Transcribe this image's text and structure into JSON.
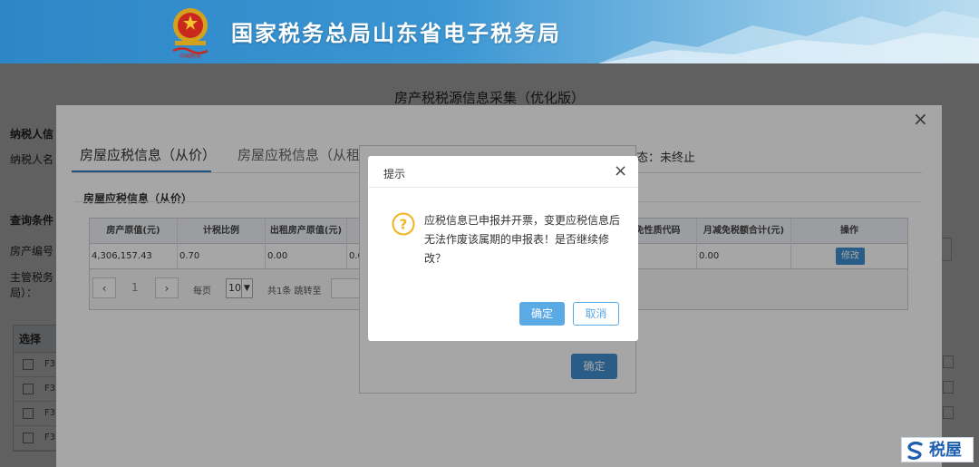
{
  "header": {
    "title": "国家税务总局山东省电子税务局",
    "emblem_caption": "中国税务"
  },
  "background_page": {
    "title": "房产税税源信息采集（优化版）",
    "taxpayer_section": "纳税人信",
    "taxpayer_name_label": "纳税人名",
    "query_section": "查询条件",
    "property_no_label": "房产编号",
    "tax_office_label_1": "主管税务",
    "tax_office_label_2": "局）：",
    "table_header": "选择",
    "row_id_fragment": "F3"
  },
  "big_dialog": {
    "close_glyph": "×",
    "tabs": [
      {
        "label": "房屋应税信息（从价）",
        "active": true
      },
      {
        "label": "房屋应税信息（从租）",
        "active": false
      }
    ],
    "status_fragment": "态：未终止",
    "section_title": "房屋应税信息（从价）",
    "columns": [
      "房产原值(元)",
      "计税比例",
      "出租房产原值(元)",
      "",
      "免性质代码",
      "月减免税额合计(元)",
      "操作"
    ],
    "row": [
      "4,306,157.43",
      "0.70",
      "0.00",
      "0.0",
      "",
      "0.00"
    ],
    "edit_button": "修改",
    "pager": {
      "prev": "‹",
      "page": "1",
      "next": "›",
      "per_page_label": "每页",
      "per_page_value": "10",
      "total_text": "共1条 跳转至"
    }
  },
  "middle_dialog": {
    "confirm_button": "确定"
  },
  "prompt_dialog": {
    "title": "提示",
    "close_glyph": "×",
    "icon": "question-icon",
    "message": "应税信息已申报并开票，变更应税信息后无法作废该属期的申报表！是否继续修改？",
    "confirm_button": "确定",
    "cancel_button": "取消",
    "accent_color": "#5aaae6"
  },
  "watermark": {
    "text": "税屋"
  }
}
